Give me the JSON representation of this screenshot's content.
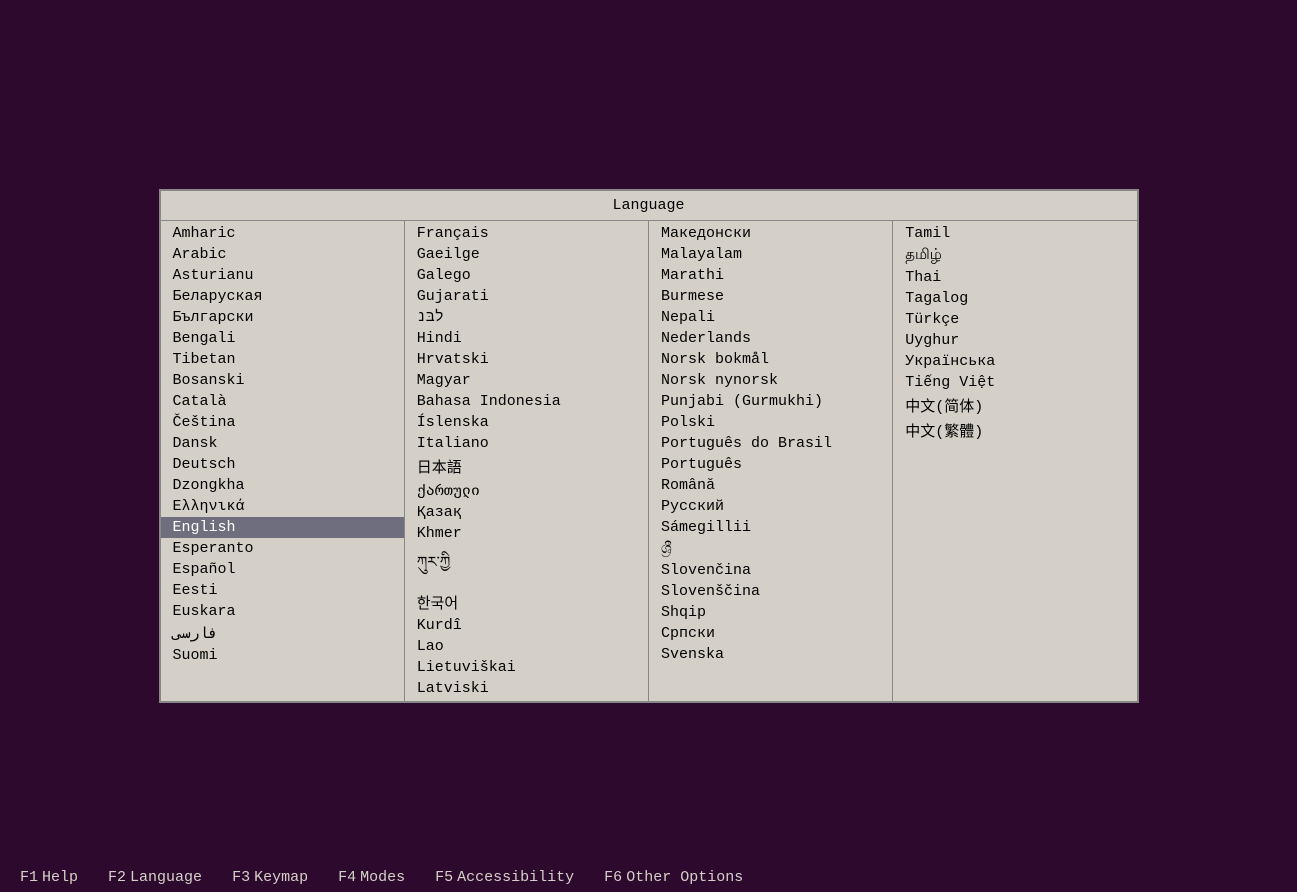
{
  "panel": {
    "title": "Language"
  },
  "columns": [
    {
      "items": [
        "Amharic",
        "Arabic",
        "Asturianu",
        "Беларуская",
        "Български",
        "Bengali",
        "Tibetan",
        "Bosanski",
        "Català",
        "Čeština",
        "Dansk",
        "Deutsch",
        "Dzongkha",
        "Ελληνικά",
        "English",
        "Esperanto",
        "Español",
        "Eesti",
        "Euskara",
        "فارسی",
        "Suomi"
      ]
    },
    {
      "items": [
        "Français",
        "Gaeilge",
        "Galego",
        "Gujarati",
        "לבּנ",
        "Hindi",
        "Hrvatski",
        "Magyar",
        "Bahasa Indonesia",
        "Íslenska",
        "Italiano",
        "日本語",
        "ქართული",
        "Қазақ",
        "Khmer",
        "ཀུར་ཀྱི",
        "한국어",
        "Kurdî",
        "Lao",
        "Lietuviškai",
        "Latviski"
      ]
    },
    {
      "items": [
        "Македонски",
        "Malayalam",
        "Marathi",
        "Burmese",
        "Nepali",
        "Nederlands",
        "Norsk bokmål",
        "Norsk nynorsk",
        "Punjabi (Gurmukhi)",
        "Polski",
        "Português do Brasil",
        "Português",
        "Română",
        "Русский",
        "Sámegillii",
        "ශ්‍රී",
        "Slovenčina",
        "Slovenščina",
        "Shqip",
        "Српски",
        "Svenska"
      ]
    },
    {
      "items": [
        "Tamil",
        "தமிழ்",
        "Thai",
        "Tagalog",
        "Türkçe",
        "Uyghur",
        "Українська",
        "Tiếng Việt",
        "中文(简体)",
        "中文(繁體)"
      ]
    }
  ],
  "selected": "English",
  "footer": {
    "items": [
      {
        "key": "F1",
        "label": "Help"
      },
      {
        "key": "F2",
        "label": "Language"
      },
      {
        "key": "F3",
        "label": "Keymap"
      },
      {
        "key": "F4",
        "label": "Modes"
      },
      {
        "key": "F5",
        "label": "Accessibility"
      },
      {
        "key": "F6",
        "label": "Other Options"
      }
    ]
  }
}
